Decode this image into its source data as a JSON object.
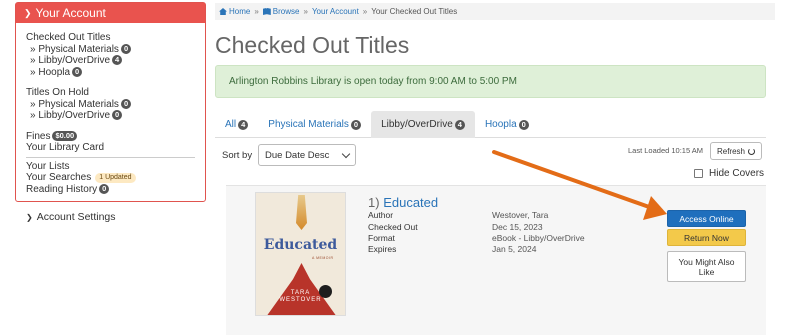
{
  "sidebar": {
    "header": "Your Account",
    "checked_out": "Checked Out Titles",
    "checked_out_items": [
      {
        "label": "Physical Materials",
        "count": "0"
      },
      {
        "label": "Libby/OverDrive",
        "count": "4"
      },
      {
        "label": "Hoopla",
        "count": "0"
      }
    ],
    "on_hold": "Titles On Hold",
    "on_hold_items": [
      {
        "label": "Physical Materials",
        "count": "0"
      },
      {
        "label": "Libby/OverDrive",
        "count": "0"
      }
    ],
    "fines": "Fines",
    "fines_amount": "$0.00",
    "library_card": "Your Library Card",
    "lists": "Your Lists",
    "searches": "Your Searches",
    "searches_badge": "1 Updated",
    "reading_history": "Reading History",
    "reading_history_count": "0",
    "account_settings": "Account Settings"
  },
  "breadcrumb": {
    "home": "Home",
    "browse": "Browse",
    "account": "Your Account",
    "current": "Your Checked Out Titles"
  },
  "page": {
    "title": "Checked Out Titles",
    "alert": "Arlington Robbins Library is open today from 9:00 AM to 5:00 PM"
  },
  "tabs": [
    {
      "label": "All",
      "count": "4"
    },
    {
      "label": "Physical Materials",
      "count": "0"
    },
    {
      "label": "Libby/OverDrive",
      "count": "4"
    },
    {
      "label": "Hoopla",
      "count": "0"
    }
  ],
  "controls": {
    "sort_label": "Sort by",
    "sort_value": "Due Date Desc",
    "last_loaded": "Last Loaded 10:15 AM",
    "refresh": "Refresh",
    "hide_covers": "Hide Covers"
  },
  "item": {
    "number": "1)",
    "title": "Educated",
    "cover": {
      "title": "Educated",
      "subtitle": "A MEMOIR",
      "author_line1": "TARA",
      "author_line2": "WESTOVER"
    },
    "details": [
      {
        "label": "Author",
        "value": "Westover, Tara"
      },
      {
        "label": "Checked Out",
        "value": "Dec 15, 2023"
      },
      {
        "label": "Format",
        "value": "eBook - Libby/OverDrive"
      },
      {
        "label": "Expires",
        "value": "Jan 5, 2024"
      }
    ],
    "buttons": {
      "access": "Access Online",
      "return": "Return Now",
      "more": "You Might Also Like"
    }
  },
  "colors": {
    "sidebar_header": "#e9534e",
    "link": "#2a74b8",
    "alert_bg": "#dff0d8",
    "access_button": "#1f6fbd",
    "return_button": "#f3c94a",
    "annotation_arrow": "#e36c17"
  }
}
